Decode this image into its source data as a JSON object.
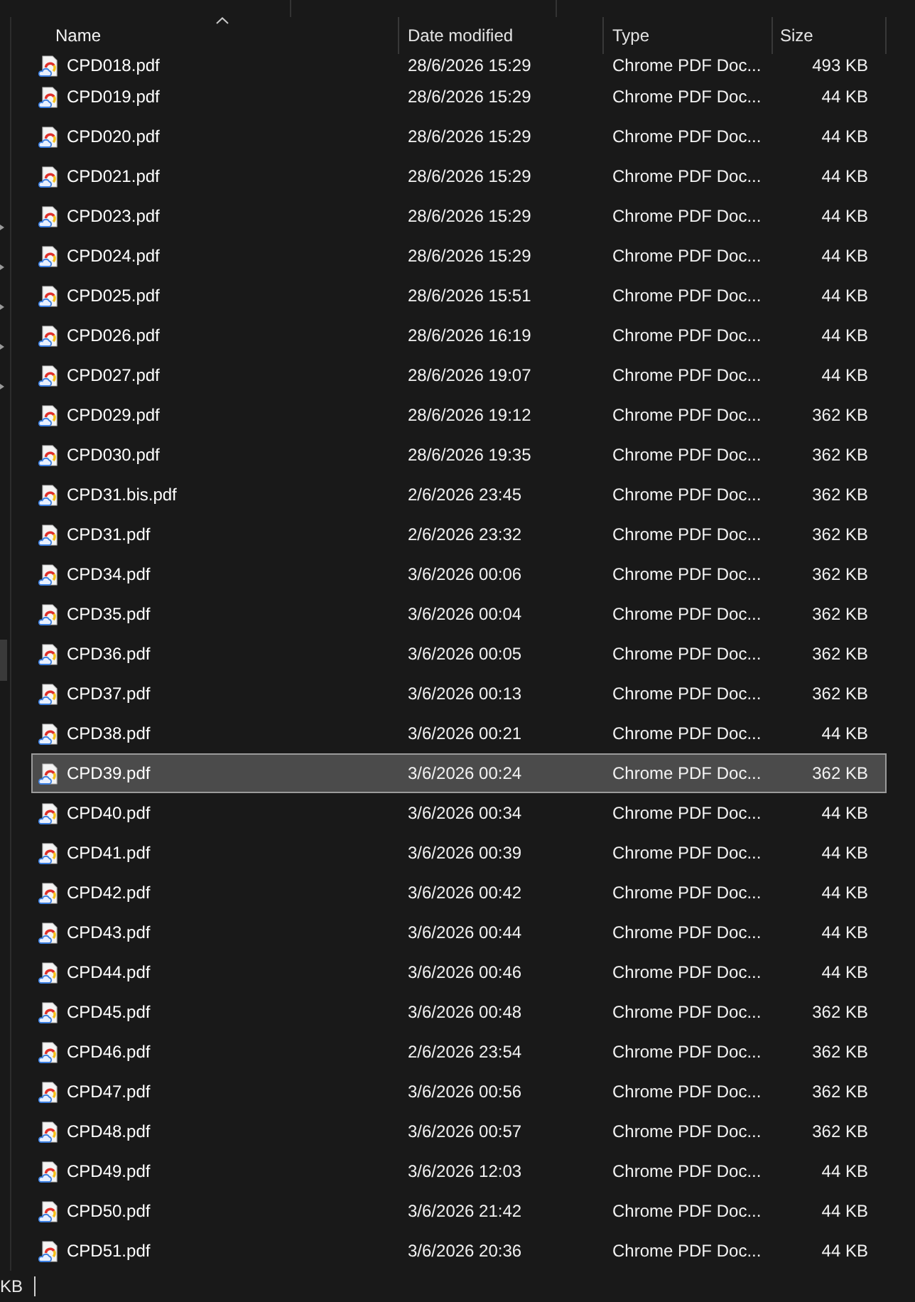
{
  "columns": [
    {
      "label": "Name",
      "sorted": true
    },
    {
      "label": "Date modified",
      "sorted": false
    },
    {
      "label": "Type",
      "sorted": false
    },
    {
      "label": "Size",
      "sorted": false
    }
  ],
  "rows": [
    {
      "name": "CPD018.pdf",
      "date": "28/6/2026 15:29",
      "type": "Chrome PDF Doc...",
      "size": "493 KB",
      "selected": false
    },
    {
      "name": "CPD019.pdf",
      "date": "28/6/2026 15:29",
      "type": "Chrome PDF Doc...",
      "size": "44 KB",
      "selected": false
    },
    {
      "name": "CPD020.pdf",
      "date": "28/6/2026 15:29",
      "type": "Chrome PDF Doc...",
      "size": "44 KB",
      "selected": false
    },
    {
      "name": "CPD021.pdf",
      "date": "28/6/2026 15:29",
      "type": "Chrome PDF Doc...",
      "size": "44 KB",
      "selected": false
    },
    {
      "name": "CPD023.pdf",
      "date": "28/6/2026 15:29",
      "type": "Chrome PDF Doc...",
      "size": "44 KB",
      "selected": false
    },
    {
      "name": "CPD024.pdf",
      "date": "28/6/2026 15:29",
      "type": "Chrome PDF Doc...",
      "size": "44 KB",
      "selected": false
    },
    {
      "name": "CPD025.pdf",
      "date": "28/6/2026 15:51",
      "type": "Chrome PDF Doc...",
      "size": "44 KB",
      "selected": false
    },
    {
      "name": "CPD026.pdf",
      "date": "28/6/2026 16:19",
      "type": "Chrome PDF Doc...",
      "size": "44 KB",
      "selected": false
    },
    {
      "name": "CPD027.pdf",
      "date": "28/6/2026 19:07",
      "type": "Chrome PDF Doc...",
      "size": "44 KB",
      "selected": false
    },
    {
      "name": "CPD029.pdf",
      "date": "28/6/2026 19:12",
      "type": "Chrome PDF Doc...",
      "size": "362 KB",
      "selected": false
    },
    {
      "name": "CPD030.pdf",
      "date": "28/6/2026 19:35",
      "type": "Chrome PDF Doc...",
      "size": "362 KB",
      "selected": false
    },
    {
      "name": "CPD31.bis.pdf",
      "date": "2/6/2026 23:45",
      "type": "Chrome PDF Doc...",
      "size": "362 KB",
      "selected": false
    },
    {
      "name": "CPD31.pdf",
      "date": "2/6/2026 23:32",
      "type": "Chrome PDF Doc...",
      "size": "362 KB",
      "selected": false
    },
    {
      "name": "CPD34.pdf",
      "date": "3/6/2026 00:06",
      "type": "Chrome PDF Doc...",
      "size": "362 KB",
      "selected": false
    },
    {
      "name": "CPD35.pdf",
      "date": "3/6/2026 00:04",
      "type": "Chrome PDF Doc...",
      "size": "362 KB",
      "selected": false
    },
    {
      "name": "CPD36.pdf",
      "date": "3/6/2026 00:05",
      "type": "Chrome PDF Doc...",
      "size": "362 KB",
      "selected": false
    },
    {
      "name": "CPD37.pdf",
      "date": "3/6/2026 00:13",
      "type": "Chrome PDF Doc...",
      "size": "362 KB",
      "selected": false
    },
    {
      "name": "CPD38.pdf",
      "date": "3/6/2026 00:21",
      "type": "Chrome PDF Doc...",
      "size": "44 KB",
      "selected": false
    },
    {
      "name": "CPD39.pdf",
      "date": "3/6/2026 00:24",
      "type": "Chrome PDF Doc...",
      "size": "362 KB",
      "selected": true
    },
    {
      "name": "CPD40.pdf",
      "date": "3/6/2026 00:34",
      "type": "Chrome PDF Doc...",
      "size": "44 KB",
      "selected": false
    },
    {
      "name": "CPD41.pdf",
      "date": "3/6/2026 00:39",
      "type": "Chrome PDF Doc...",
      "size": "44 KB",
      "selected": false
    },
    {
      "name": "CPD42.pdf",
      "date": "3/6/2026 00:42",
      "type": "Chrome PDF Doc...",
      "size": "44 KB",
      "selected": false
    },
    {
      "name": "CPD43.pdf",
      "date": "3/6/2026 00:44",
      "type": "Chrome PDF Doc...",
      "size": "44 KB",
      "selected": false
    },
    {
      "name": "CPD44.pdf",
      "date": "3/6/2026 00:46",
      "type": "Chrome PDF Doc...",
      "size": "44 KB",
      "selected": false
    },
    {
      "name": "CPD45.pdf",
      "date": "3/6/2026 00:48",
      "type": "Chrome PDF Doc...",
      "size": "362 KB",
      "selected": false
    },
    {
      "name": "CPD46.pdf",
      "date": "2/6/2026 23:54",
      "type": "Chrome PDF Doc...",
      "size": "362 KB",
      "selected": false
    },
    {
      "name": "CPD47.pdf",
      "date": "3/6/2026 00:56",
      "type": "Chrome PDF Doc...",
      "size": "362 KB",
      "selected": false
    },
    {
      "name": "CPD48.pdf",
      "date": "3/6/2026 00:57",
      "type": "Chrome PDF Doc...",
      "size": "362 KB",
      "selected": false
    },
    {
      "name": "CPD49.pdf",
      "date": "3/6/2026 12:03",
      "type": "Chrome PDF Doc...",
      "size": "44 KB",
      "selected": false
    },
    {
      "name": "CPD50.pdf",
      "date": "3/6/2026 21:42",
      "type": "Chrome PDF Doc...",
      "size": "44 KB",
      "selected": false
    },
    {
      "name": "CPD51.pdf",
      "date": "3/6/2026 20:36",
      "type": "Chrome PDF Doc...",
      "size": "44 KB",
      "selected": false
    }
  ],
  "status_bar": {
    "text": "KB"
  }
}
